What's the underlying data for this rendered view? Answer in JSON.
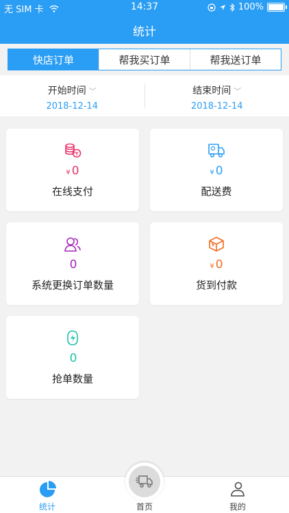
{
  "status": {
    "carrier": "无 SIM 卡",
    "time": "14:37",
    "battery": "100%"
  },
  "header": {
    "title": "统计"
  },
  "tabs": [
    {
      "label": "快店订单"
    },
    {
      "label": "帮我买订单"
    },
    {
      "label": "帮我送订单"
    }
  ],
  "dates": {
    "start": {
      "label": "开始时间",
      "value": "2018-12-14"
    },
    "end": {
      "label": "结束时间",
      "value": "2018-12-14"
    }
  },
  "cards": [
    {
      "yen": "¥",
      "value": "0",
      "label": "在线支付",
      "icon": "coins-icon",
      "color": "#e8336b"
    },
    {
      "yen": "¥",
      "value": "0",
      "label": "配送费",
      "icon": "delivery-truck-icon",
      "color": "#2a9df4"
    },
    {
      "yen": "",
      "value": "0",
      "label": "系统更换订单数量",
      "icon": "users-icon",
      "color": "#a424b9"
    },
    {
      "yen": "¥",
      "value": "0",
      "label": "货到付款",
      "icon": "package-icon",
      "color": "#f26b21"
    },
    {
      "yen": "",
      "value": "0",
      "label": "抢单数量",
      "icon": "grab-order-icon",
      "color": "#1ec0a8"
    }
  ],
  "bottom_nav": [
    {
      "label": "统计",
      "icon": "pie-chart-icon",
      "active": true
    },
    {
      "label": "首页",
      "icon": "truck-icon"
    },
    {
      "label": "我的",
      "icon": "profile-icon"
    }
  ],
  "colors": {
    "primary": "#2a9df4"
  }
}
